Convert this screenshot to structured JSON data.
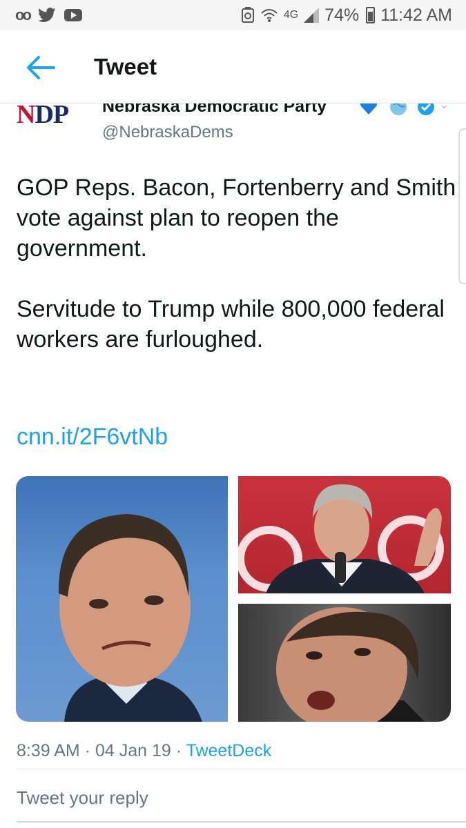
{
  "status_bar": {
    "icons_left": [
      "voicemail-icon",
      "twitter-bird-icon",
      "youtube-icon"
    ],
    "network": "4G",
    "battery": "74%",
    "time": "11:42 AM"
  },
  "header": {
    "title": "Tweet",
    "back_icon": "arrow-left-icon"
  },
  "author": {
    "avatar_text_a": "N",
    "avatar_text_b": "DP",
    "display_name": "Nebraska Democratic Party",
    "handle": "@NebraskaDems"
  },
  "tweet": {
    "paragraph1": "GOP Reps. Bacon, Fortenberry and Smith vote against plan to reopen the government.",
    "paragraph2": "Servitude to Trump while 800,000 federal workers are furloughed.",
    "link": "cnn.it/2F6vtNb"
  },
  "meta": {
    "time": "8:39 AM",
    "separator": "·",
    "date": "04 Jan 19",
    "source": "TweetDeck"
  },
  "reply": {
    "placeholder": "Tweet your reply"
  },
  "colors": {
    "link": "#1da1f2",
    "secondary_text": "#657786",
    "logo_red": "#c8102e",
    "logo_navy": "#1b2a6b"
  }
}
